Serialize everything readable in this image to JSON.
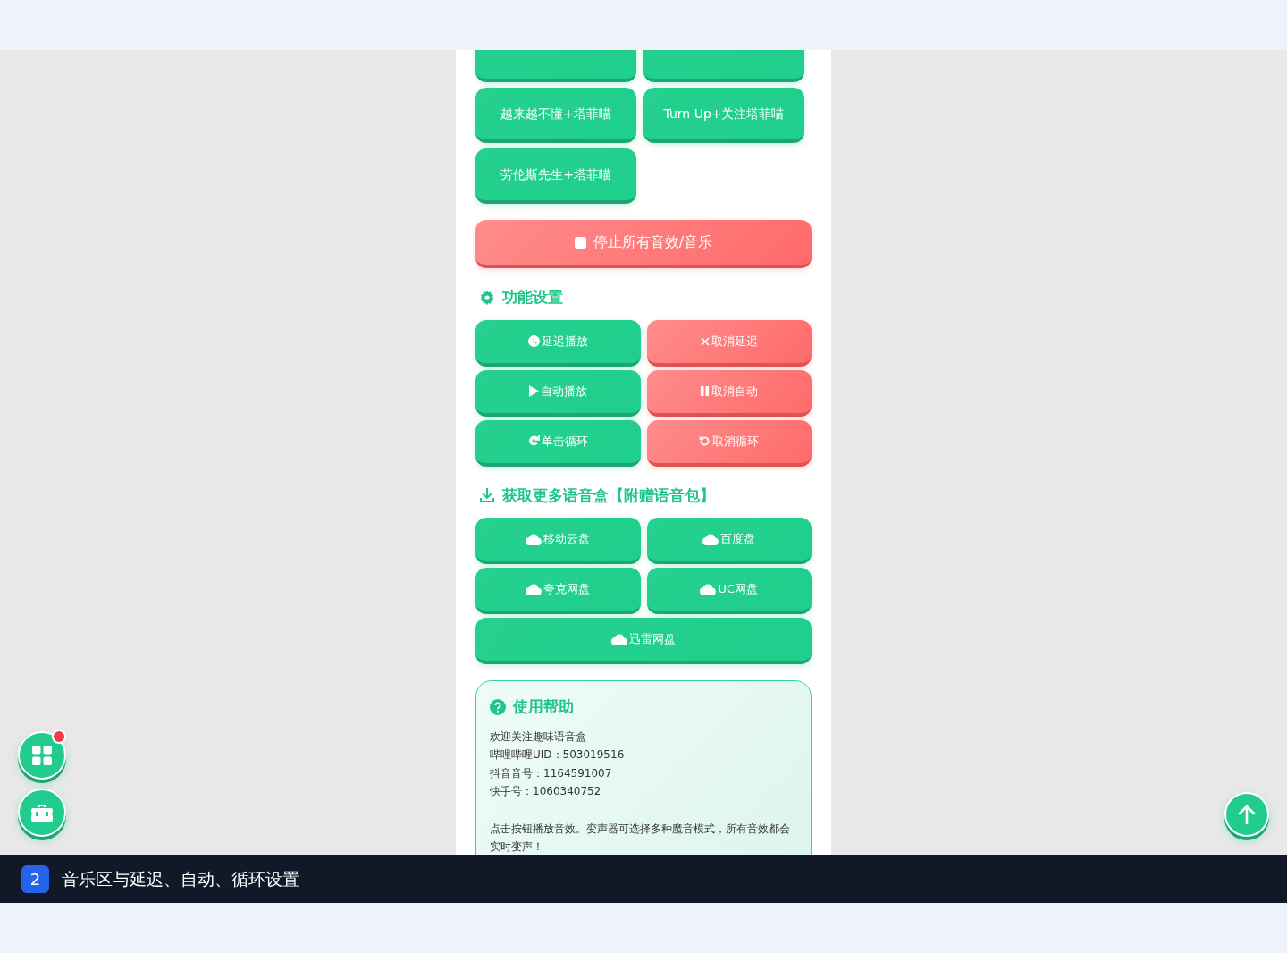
{
  "sound_buttons": [
    {
      "kind": "cut"
    },
    {
      "kind": "cut"
    },
    {
      "kind": "full",
      "label": "越来越不懂+塔菲喵"
    },
    {
      "kind": "full",
      "label": "Turn Up+关注塔菲喵"
    },
    {
      "kind": "full",
      "label": "劳伦斯先生+塔菲喵"
    }
  ],
  "stop_button": {
    "label": "停止所有音效/音乐"
  },
  "settings": {
    "title": "功能设置",
    "buttons": [
      {
        "kind": "action",
        "label": "延迟播放"
      },
      {
        "kind": "cancel",
        "label": "取消延迟"
      },
      {
        "kind": "action",
        "label": "自动播放"
      },
      {
        "kind": "cancel",
        "label": "取消自动"
      },
      {
        "kind": "action",
        "label": "单击循环"
      },
      {
        "kind": "cancel",
        "label": "取消循环"
      }
    ]
  },
  "downloads": {
    "title": "获取更多语音盒【附赠语音包】",
    "buttons": [
      {
        "label": "移动云盘"
      },
      {
        "label": "百度盘"
      },
      {
        "label": "夸克网盘"
      },
      {
        "label": "UC网盘"
      },
      {
        "label": "迅雷网盘"
      }
    ]
  },
  "help": {
    "title": "使用帮助",
    "lines": [
      "欢迎关注趣味语音盒",
      "哔哩哔哩UID：503019516",
      "抖音音号：1164591007",
      "快手号：1060340752"
    ],
    "note": "点击按钮播放音效。变声器可选择多种魔音模式，所有音效都会实时变声！"
  },
  "fabs": {
    "apps_badge": true
  },
  "caption": {
    "step": "2",
    "text": "音乐区与延迟、自动、循环设置"
  }
}
